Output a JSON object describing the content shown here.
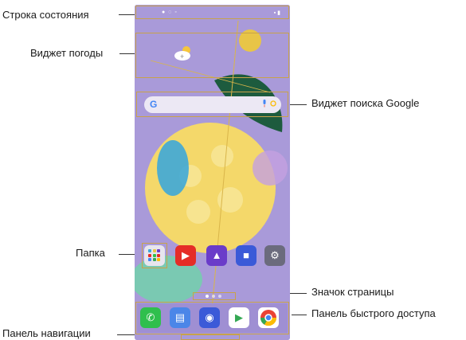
{
  "callouts": {
    "status_bar": "Строка состояния",
    "weather_widget": "Виджет погоды",
    "google_search_widget": "Виджет поиска Google",
    "folder": "Папка",
    "page_indicator": "Значок страницы",
    "quick_access_panel": "Панель быстрого доступа",
    "navigation_bar": "Панель навигации"
  },
  "search": {
    "logo": "G"
  },
  "colors": {
    "highlight": "#c8a24a",
    "wallpaper": "#a99ad9",
    "phone_icon": "#2fbf4d",
    "youtube": "#e52d27",
    "gallery": "#6a3cc9",
    "video": "#3b5ad8",
    "settings": "#6b6b7d",
    "play": "#34a853"
  },
  "apps_row": [
    "folder-icon",
    "youtube-icon",
    "gallery-icon",
    "video-camera-icon",
    "settings-icon"
  ],
  "dock_apps": [
    "phone-icon",
    "messages-icon",
    "camera-icon",
    "play-store-icon",
    "chrome-icon"
  ]
}
